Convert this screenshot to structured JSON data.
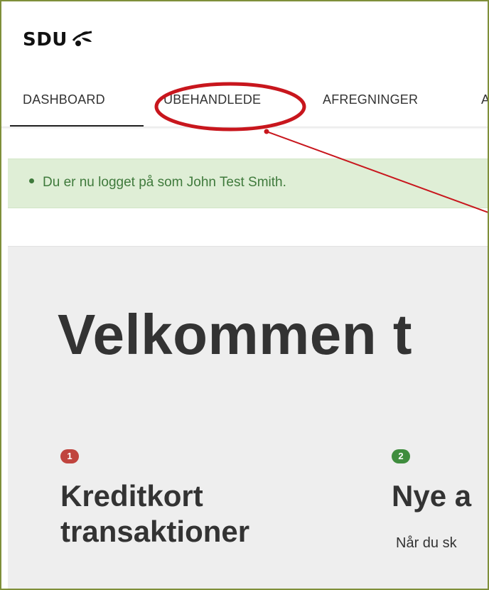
{
  "logo": {
    "text": "SDU",
    "icon": "sdu-olive-branch-icon"
  },
  "nav": {
    "items": [
      {
        "label": "DASHBOARD",
        "active": true
      },
      {
        "label": "UBEHANDLEDE",
        "active": false
      },
      {
        "label": "AFREGNINGER",
        "active": false
      },
      {
        "label": "A",
        "active": false
      }
    ]
  },
  "alert": {
    "message": "Du er nu logget på som John Test Smith."
  },
  "hero": {
    "title": "Velkommen t",
    "cards": [
      {
        "badge": "1",
        "title_line1": "Kreditkort",
        "title_line2": "transaktioner"
      },
      {
        "badge": "2",
        "title_line1": "Nye a",
        "desc": "Når du sk"
      }
    ]
  },
  "colors": {
    "alert_bg": "#dfeed6",
    "alert_text": "#3f7a3c",
    "badge_red": "#c0443e",
    "badge_green": "#3f8d3e",
    "annotation_red": "#c8161d",
    "frame_border": "#7f8f3a"
  }
}
